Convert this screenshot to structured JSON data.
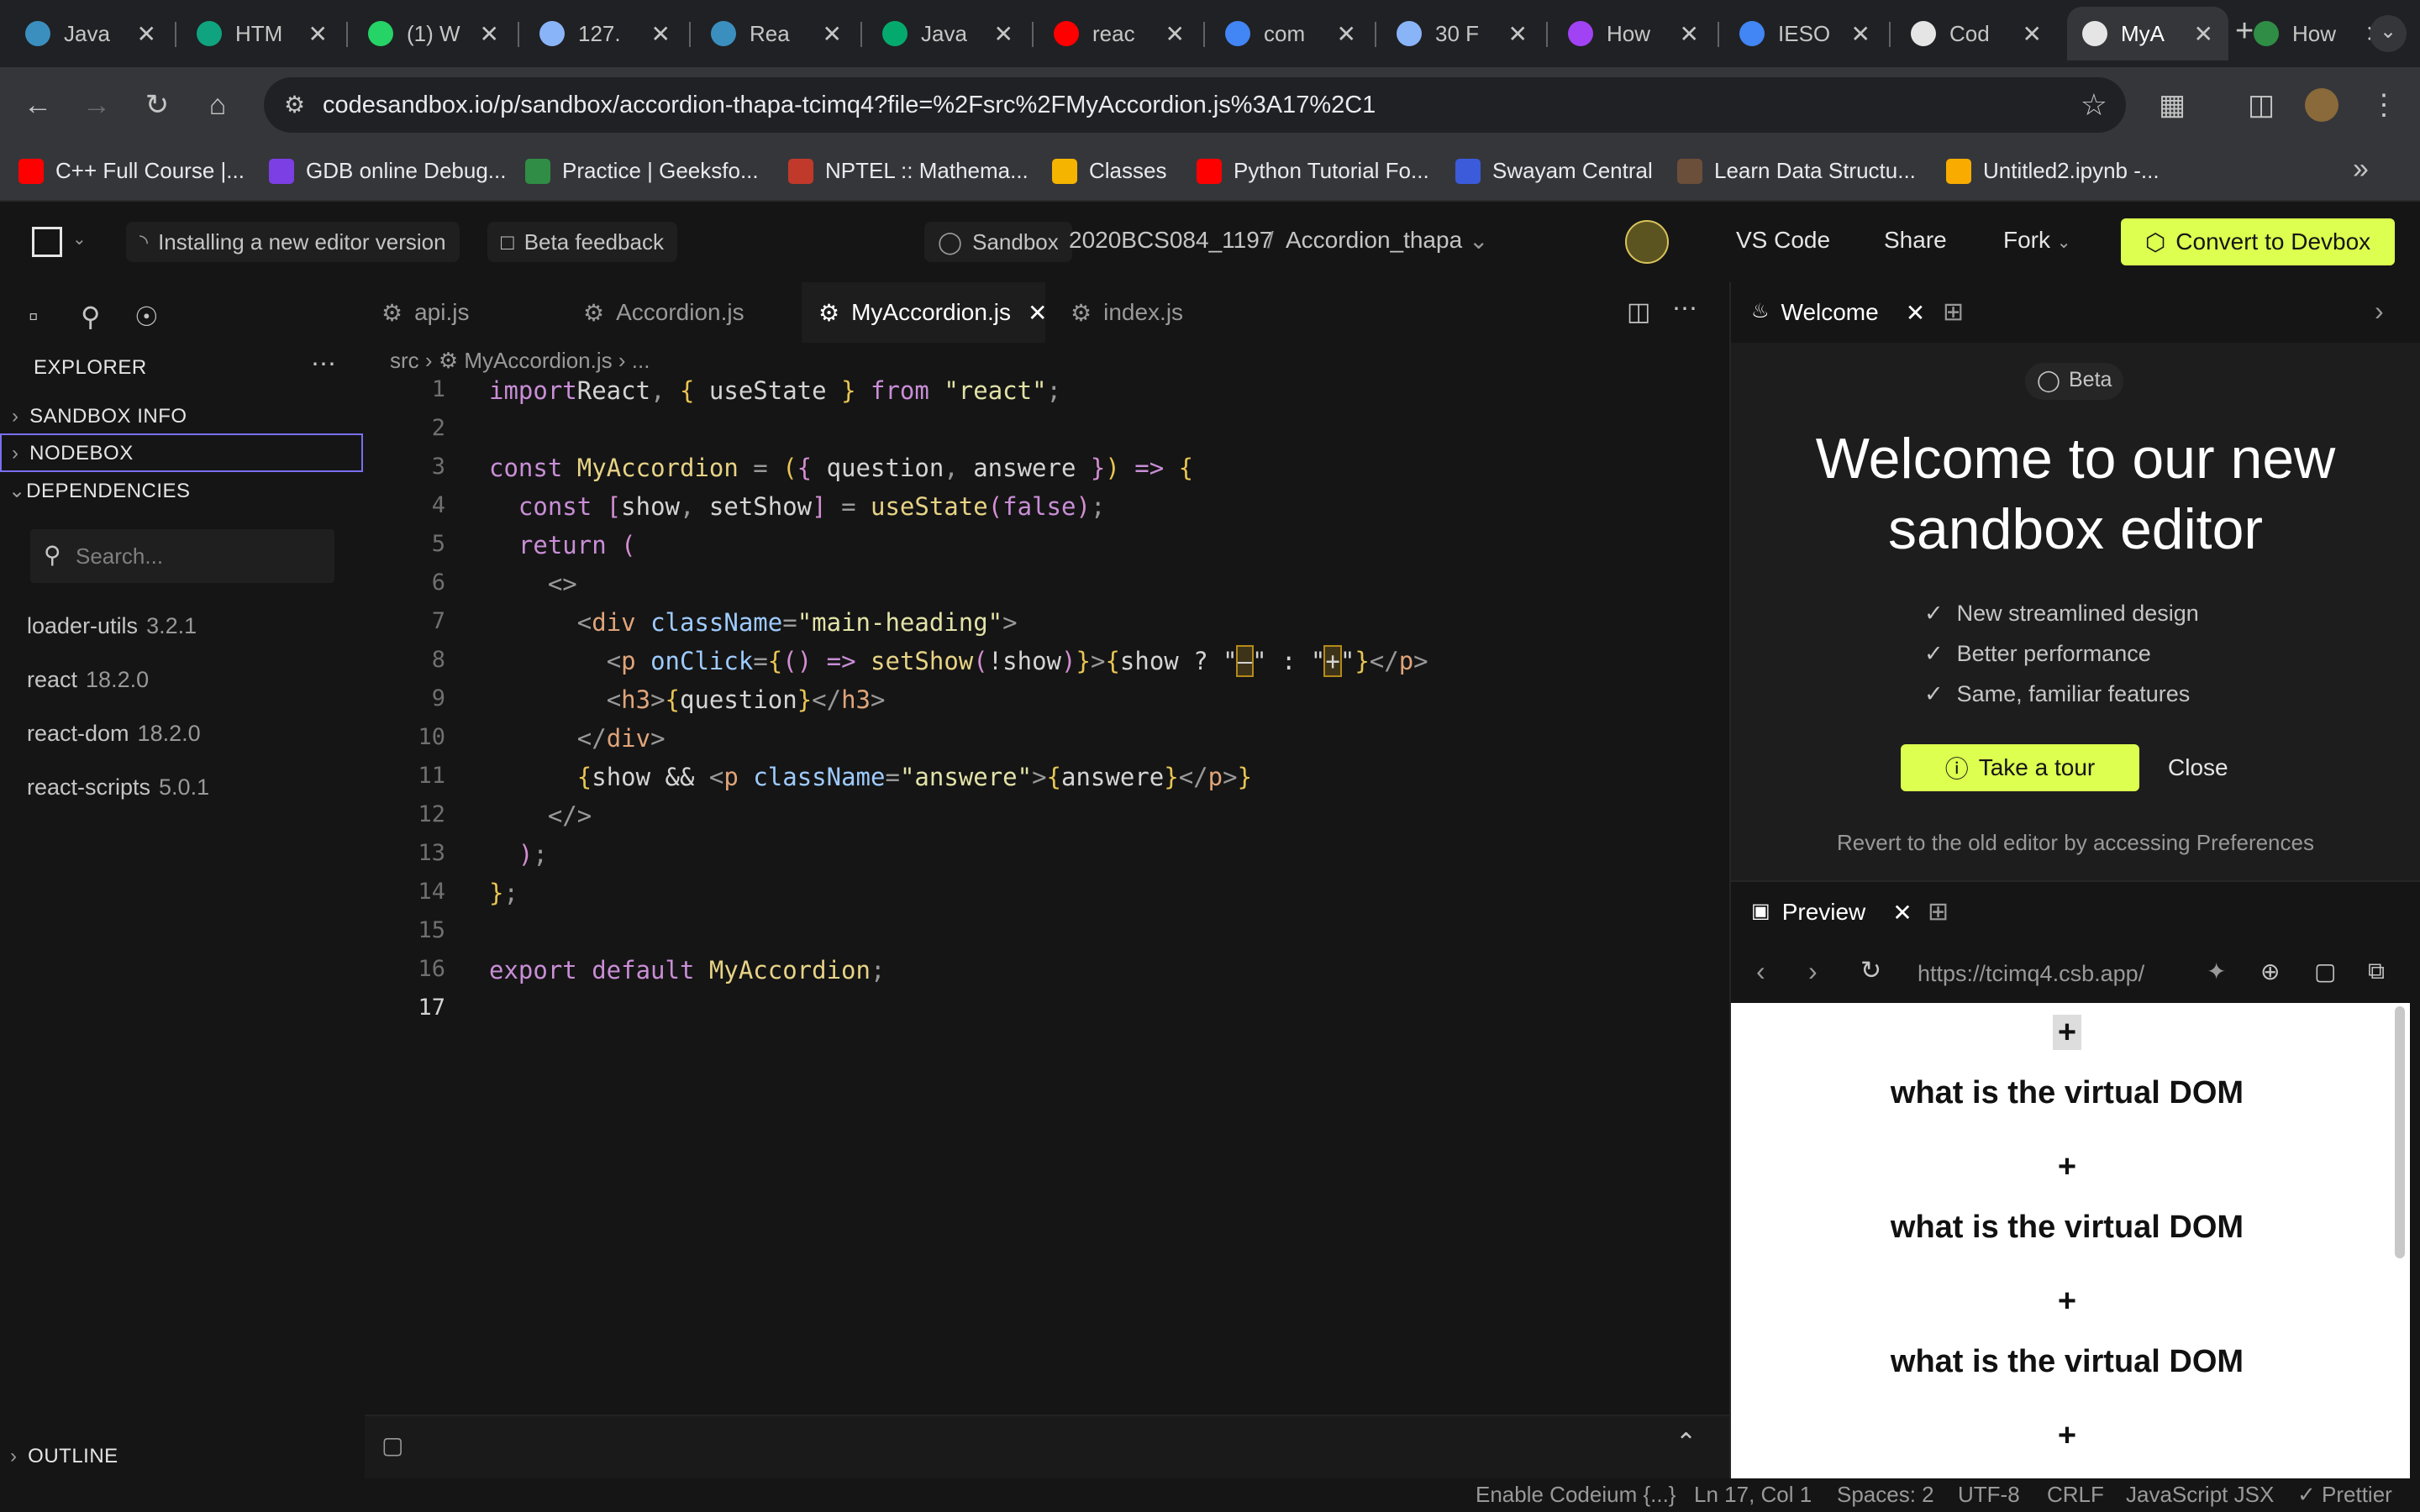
{
  "browser": {
    "tabs": [
      {
        "title": "Java",
        "icon": "mountain-icon",
        "color": "#3b8fbf"
      },
      {
        "title": "HTM",
        "icon": "chatgpt-icon",
        "color": "#10a37f"
      },
      {
        "title": "(1) W",
        "icon": "whatsapp-icon",
        "color": "#25d366"
      },
      {
        "title": "127.",
        "icon": "globe-icon",
        "color": "#8ab4f8"
      },
      {
        "title": "Rea",
        "icon": "mountain-icon",
        "color": "#3b8fbf"
      },
      {
        "title": "Java",
        "icon": "w3schools-icon",
        "color": "#04aa6d"
      },
      {
        "title": "reac",
        "icon": "youtube-icon",
        "color": "#ff0000"
      },
      {
        "title": "com",
        "icon": "google-icon",
        "color": "#4285f4"
      },
      {
        "title": "30 F",
        "icon": "terminal-icon",
        "color": "#8ab4f8"
      },
      {
        "title": "How",
        "icon": "info-icon",
        "color": "#a142f4"
      },
      {
        "title": "IESO",
        "icon": "google-icon",
        "color": "#4285f4"
      },
      {
        "title": "Cod",
        "icon": "codesandbox-icon",
        "color": "#e5e5e5"
      },
      {
        "title": "MyA",
        "icon": "codesandbox-icon",
        "color": "#e5e5e5",
        "active": true
      },
      {
        "title": "How",
        "icon": "geeksforgeeks-icon",
        "color": "#2f8d46"
      }
    ],
    "url": "codesandbox.io/p/sandbox/accordion-thapa-tcimq4?file=%2Fsrc%2FMyAccordion.js%3A17%2C1",
    "bookmarks": [
      {
        "label": "C++ Full Course |...",
        "icon": "youtube-icon",
        "color": "#ff0000"
      },
      {
        "label": "GDB online Debug...",
        "icon": "bolt-icon",
        "color": "#7b3fe4"
      },
      {
        "label": "Practice | Geeksfo...",
        "icon": "geeksforgeeks-icon",
        "color": "#2f8d46"
      },
      {
        "label": "NPTEL :: Mathema...",
        "icon": "nptel-icon",
        "color": "#c0392b"
      },
      {
        "label": "Classes",
        "icon": "classroom-icon",
        "color": "#f4b400"
      },
      {
        "label": "Python Tutorial Fo...",
        "icon": "youtube-icon",
        "color": "#ff0000"
      },
      {
        "label": "Swayam Central",
        "icon": "swayam-icon",
        "color": "#3b5bdb"
      },
      {
        "label": "Learn Data Structu...",
        "icon": "cc-icon",
        "color": "#6b4f3a"
      },
      {
        "label": "Untitled2.ipynb -...",
        "icon": "colab-icon",
        "color": "#f9ab00"
      }
    ]
  },
  "csb": {
    "editor_status": "Installing a new editor version",
    "beta_feedback": "Beta feedback",
    "sandbox_label": "Sandbox",
    "owner": "2020BCS084_1197",
    "separator": "/",
    "project": "Accordion_thapa",
    "vscode": "VS Code",
    "share": "Share",
    "fork": "Fork",
    "devbox": "Convert to Devbox",
    "accent": "#dcff50"
  },
  "explorer": {
    "title": "EXPLORER",
    "sections": [
      "SANDBOX INFO",
      "NODEBOX",
      "DEPENDENCIES"
    ],
    "search_placeholder": "Search...",
    "deps": [
      {
        "name": "loader-utils",
        "version": "3.2.1"
      },
      {
        "name": "react",
        "version": "18.2.0"
      },
      {
        "name": "react-dom",
        "version": "18.2.0"
      },
      {
        "name": "react-scripts",
        "version": "5.0.1"
      }
    ],
    "outline": "OUTLINE"
  },
  "editor": {
    "tabs": [
      "api.js",
      "Accordion.js",
      "MyAccordion.js",
      "index.js"
    ],
    "active_tab": "MyAccordion.js",
    "breadcrumb": {
      "folder": "src",
      "file": "MyAccordion.js",
      "rest": "..."
    },
    "line_numbers": [
      "1",
      "2",
      "3",
      "4",
      "5",
      "6",
      "7",
      "8",
      "9",
      "10",
      "11",
      "12",
      "13",
      "14",
      "15",
      "16",
      "17"
    ]
  },
  "welcome": {
    "tab": "Welcome",
    "badge": "Beta",
    "title_line1": "Welcome to our new",
    "title_line2": "sandbox editor",
    "features": [
      "New streamlined design",
      "Better performance",
      "Same, familiar features"
    ],
    "tour": "Take a tour",
    "close": "Close",
    "note": "Revert to the old editor by accessing Preferences"
  },
  "preview": {
    "tab": "Preview",
    "url": "https://tcimq4.csb.app/",
    "items": [
      {
        "toggle": "+",
        "question": "what is the virtual DOM"
      },
      {
        "toggle": "+",
        "question": "what is the virtual DOM"
      },
      {
        "toggle": "+",
        "question": "what is the virtual DOM"
      },
      {
        "toggle": "+",
        "question": ""
      }
    ]
  },
  "status": {
    "codeium": "Enable Codeium {...}",
    "position": "Ln 17, Col 1",
    "spaces": "Spaces: 2",
    "encoding": "UTF-8",
    "eol": "CRLF",
    "language": "JavaScript JSX",
    "prettier": "✓ Prettier"
  }
}
